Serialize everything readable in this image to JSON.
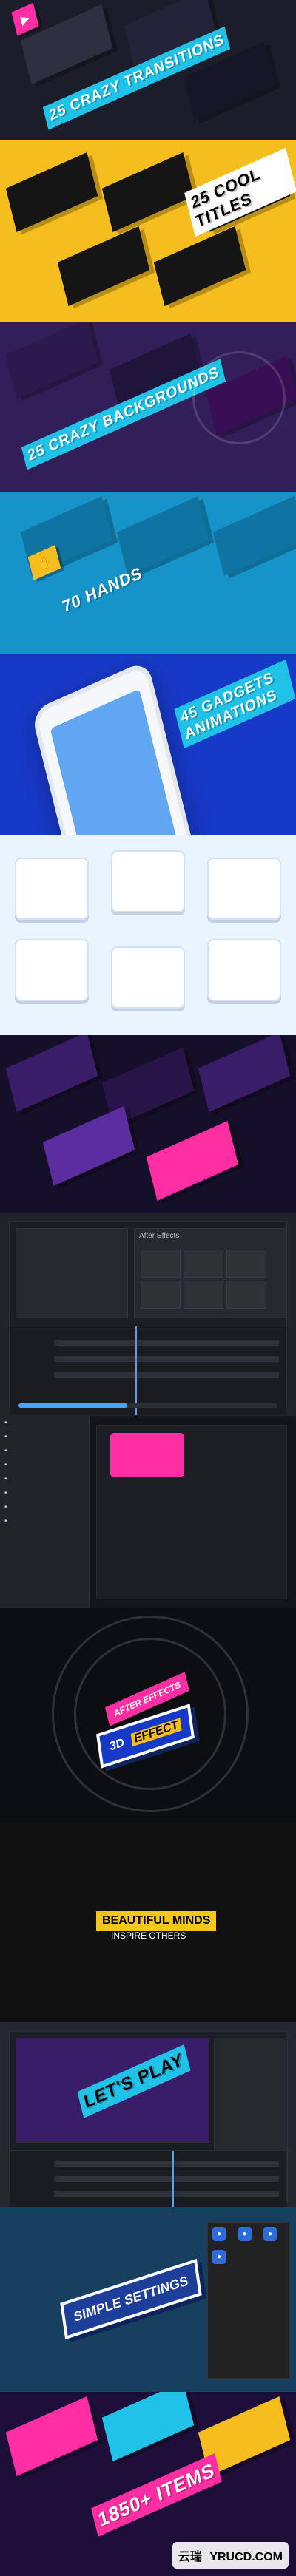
{
  "labels": {
    "transitions": "25 CRAZY TRANSITIONS",
    "titles": "25 COOL TITLES",
    "backgrounds": "25 CRAZY BACKGROUNDS",
    "hands": "70 HANDS",
    "gadgets": "45 GADGETS ANIMATIONS",
    "ae_panels": "After Effects",
    "fx_badge": "AFTER EFFECTS",
    "fx_3d": "3D",
    "fx_effect": "EFFECT",
    "beautiful": "BEAUTIFUL MINDS",
    "inspire": "INSPIRE OTHERS",
    "lets_play": "LET'S PLAY",
    "simple_settings": "SIMPLE SETTINGS",
    "items_big": "1850+ ITEMS",
    "watermark_cn": "云瑞",
    "watermark_en": "YRUCD.COM"
  },
  "colors": {
    "pink": "#ff2fa3",
    "cyan": "#21c2e8",
    "yellow": "#f6bd1f",
    "blue": "#1693c9",
    "purple": "#321f59"
  },
  "values": {
    "ui_progress_percent": 42
  }
}
